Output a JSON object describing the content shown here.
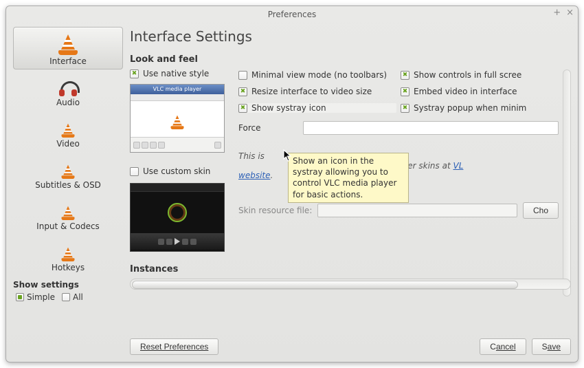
{
  "window": {
    "title": "Preferences"
  },
  "sidebar": {
    "items": [
      {
        "label": "Interface"
      },
      {
        "label": "Audio"
      },
      {
        "label": "Video"
      },
      {
        "label": "Subtitles & OSD"
      },
      {
        "label": "Input & Codecs"
      },
      {
        "label": "Hotkeys"
      }
    ],
    "show_settings": {
      "title": "Show settings",
      "simple": "Simple",
      "all": "All"
    }
  },
  "panel": {
    "title": "Interface Settings",
    "sections": {
      "look": "Look and feel",
      "instances": "Instances"
    },
    "look": {
      "use_native": "Use native style",
      "use_custom": "Use custom skin",
      "minimal": "Minimal view mode (no toolbars)",
      "resize": "Resize interface to video size",
      "systray": "Show systray icon",
      "show_controls": "Show controls in full scree",
      "embed": "Embed video in interface",
      "systray_popup": "Systray popup when minim",
      "force_label": "Force",
      "skin_note_a": "This is",
      "skin_note_b": ". You can download other skins at ",
      "skin_link": "VL",
      "skin_website": "website",
      "skin_resource": "Skin resource file:",
      "choose": "Cho"
    }
  },
  "tooltip": "Show an icon in the systray allowing you to control VLC media player for basic actions.",
  "buttons": {
    "reset": "Reset Preferences",
    "cancel_pre": "C",
    "cancel_ul": "ancel",
    "save_pre": "S",
    "save_ul": "ave"
  }
}
